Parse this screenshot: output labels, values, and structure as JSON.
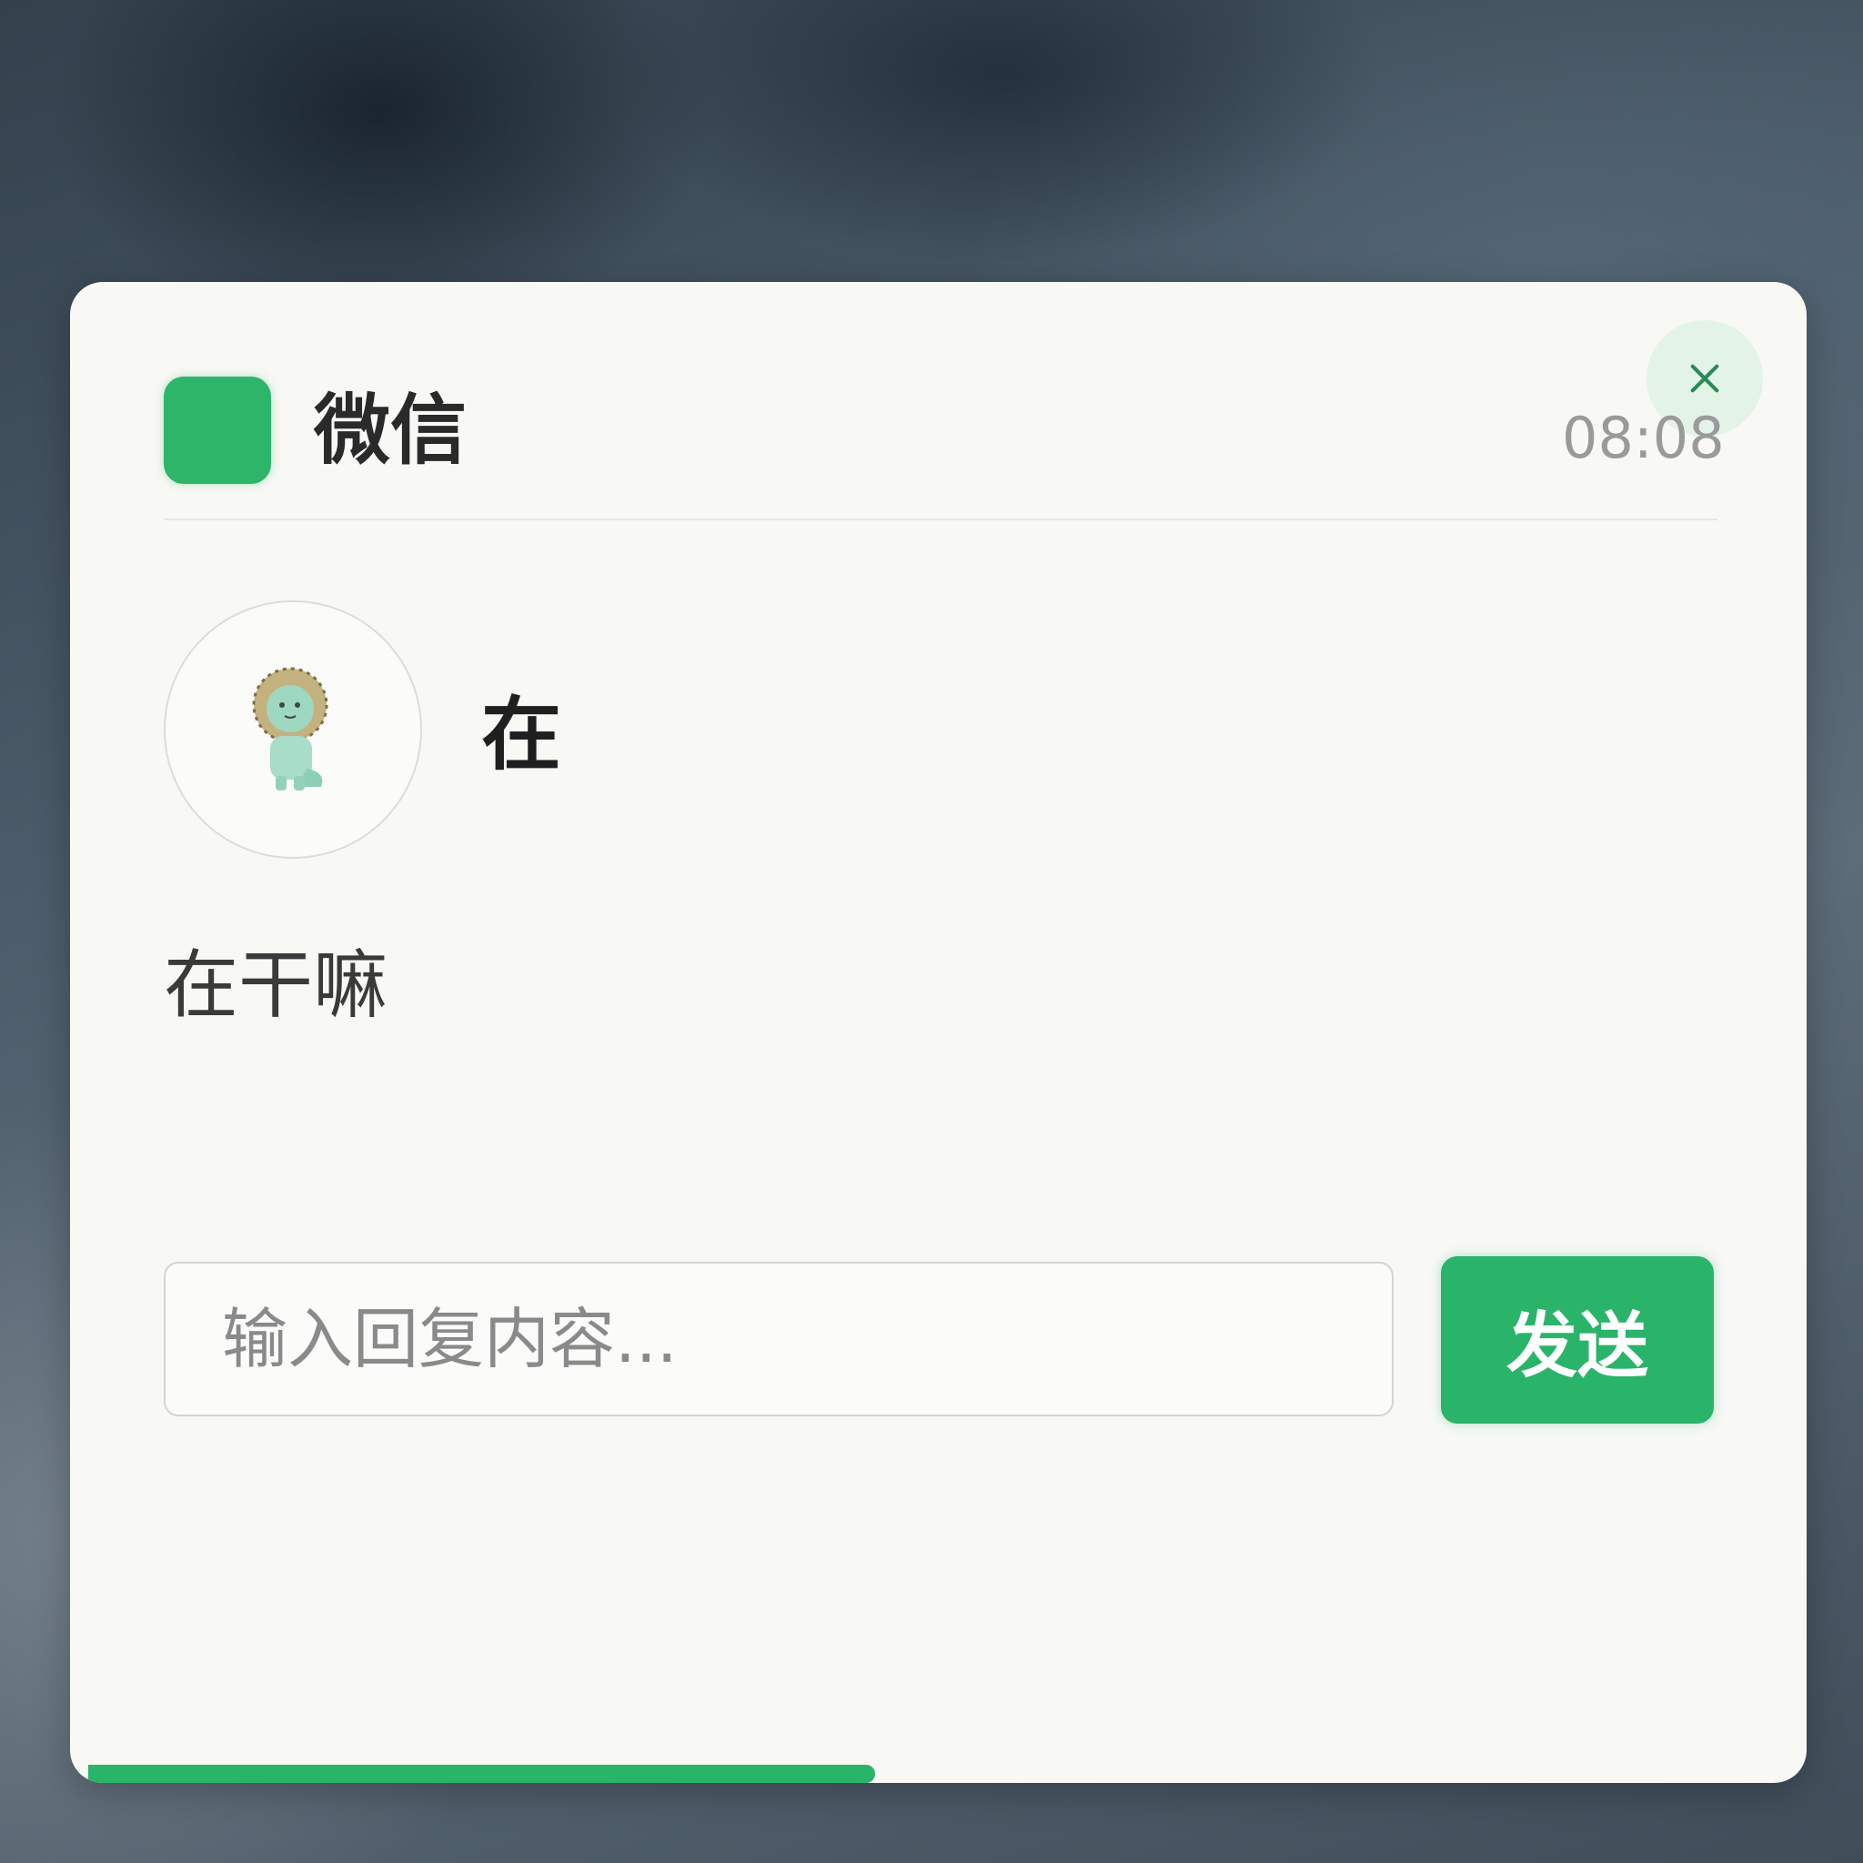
{
  "notification": {
    "app_name": "微信",
    "time": "08:08",
    "close_icon": "close-icon",
    "sender": {
      "avatar_icon": "lion-avatar-icon",
      "name": "在"
    },
    "message": "在干嘛",
    "reply": {
      "placeholder": "输入回复内容...",
      "value": ""
    },
    "send_label": "发送",
    "progress_fraction": 0.46,
    "colors": {
      "accent": "#2ab46a",
      "card_background": "#f8f8f5",
      "time_text": "#9a9a9a"
    }
  }
}
